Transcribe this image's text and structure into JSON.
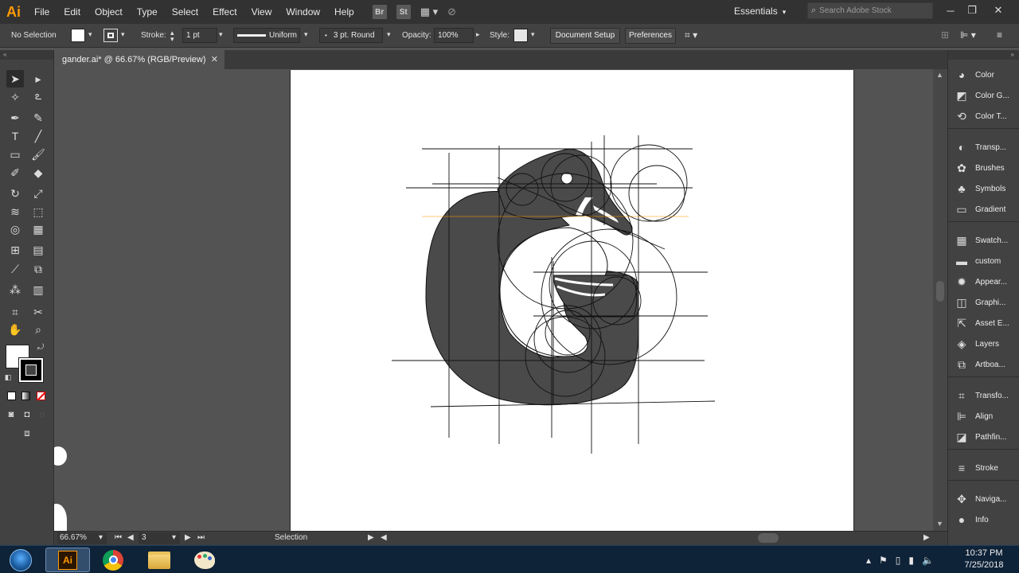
{
  "app": {
    "logo": "Ai"
  },
  "menu": [
    "File",
    "Edit",
    "Object",
    "Type",
    "Select",
    "Effect",
    "View",
    "Window",
    "Help"
  ],
  "menubar_icons": {
    "bridge": "Br",
    "stock": "St"
  },
  "workspace": "Essentials",
  "search": {
    "placeholder": "Search Adobe Stock"
  },
  "control": {
    "selection": "No Selection",
    "stroke_label": "Stroke:",
    "stroke_weight": "1 pt",
    "profile": "Uniform",
    "brush": "3 pt. Round",
    "opacity_label": "Opacity:",
    "opacity": "100%",
    "style_label": "Style:",
    "document_setup": "Document Setup",
    "preferences": "Preferences"
  },
  "document": {
    "tab_title": "gander.ai* @ 66.67% (RGB/Preview)"
  },
  "status": {
    "zoom": "66.67%",
    "artboard_number": "3",
    "tool": "Selection"
  },
  "dock_panels": [
    "Color",
    "Color G...",
    "Color T...",
    "Transp...",
    "Brushes",
    "Symbols",
    "Gradient",
    "Swatch...",
    "custom",
    "Appear...",
    "Graphi...",
    "Asset E...",
    "Layers",
    "Artboa...",
    "Transfo...",
    "Align",
    "Pathfin...",
    "Stroke",
    "Naviga...",
    "Info"
  ],
  "taskbar": {
    "time": "10:37 PM",
    "date": "7/25/2018",
    "apps": [
      "illustrator",
      "chrome",
      "file-explorer",
      "paint"
    ]
  },
  "colors": {
    "artwork_fill": "#4a4a4a",
    "accent": "#ff9a00",
    "guide": "#1a1a1a"
  }
}
